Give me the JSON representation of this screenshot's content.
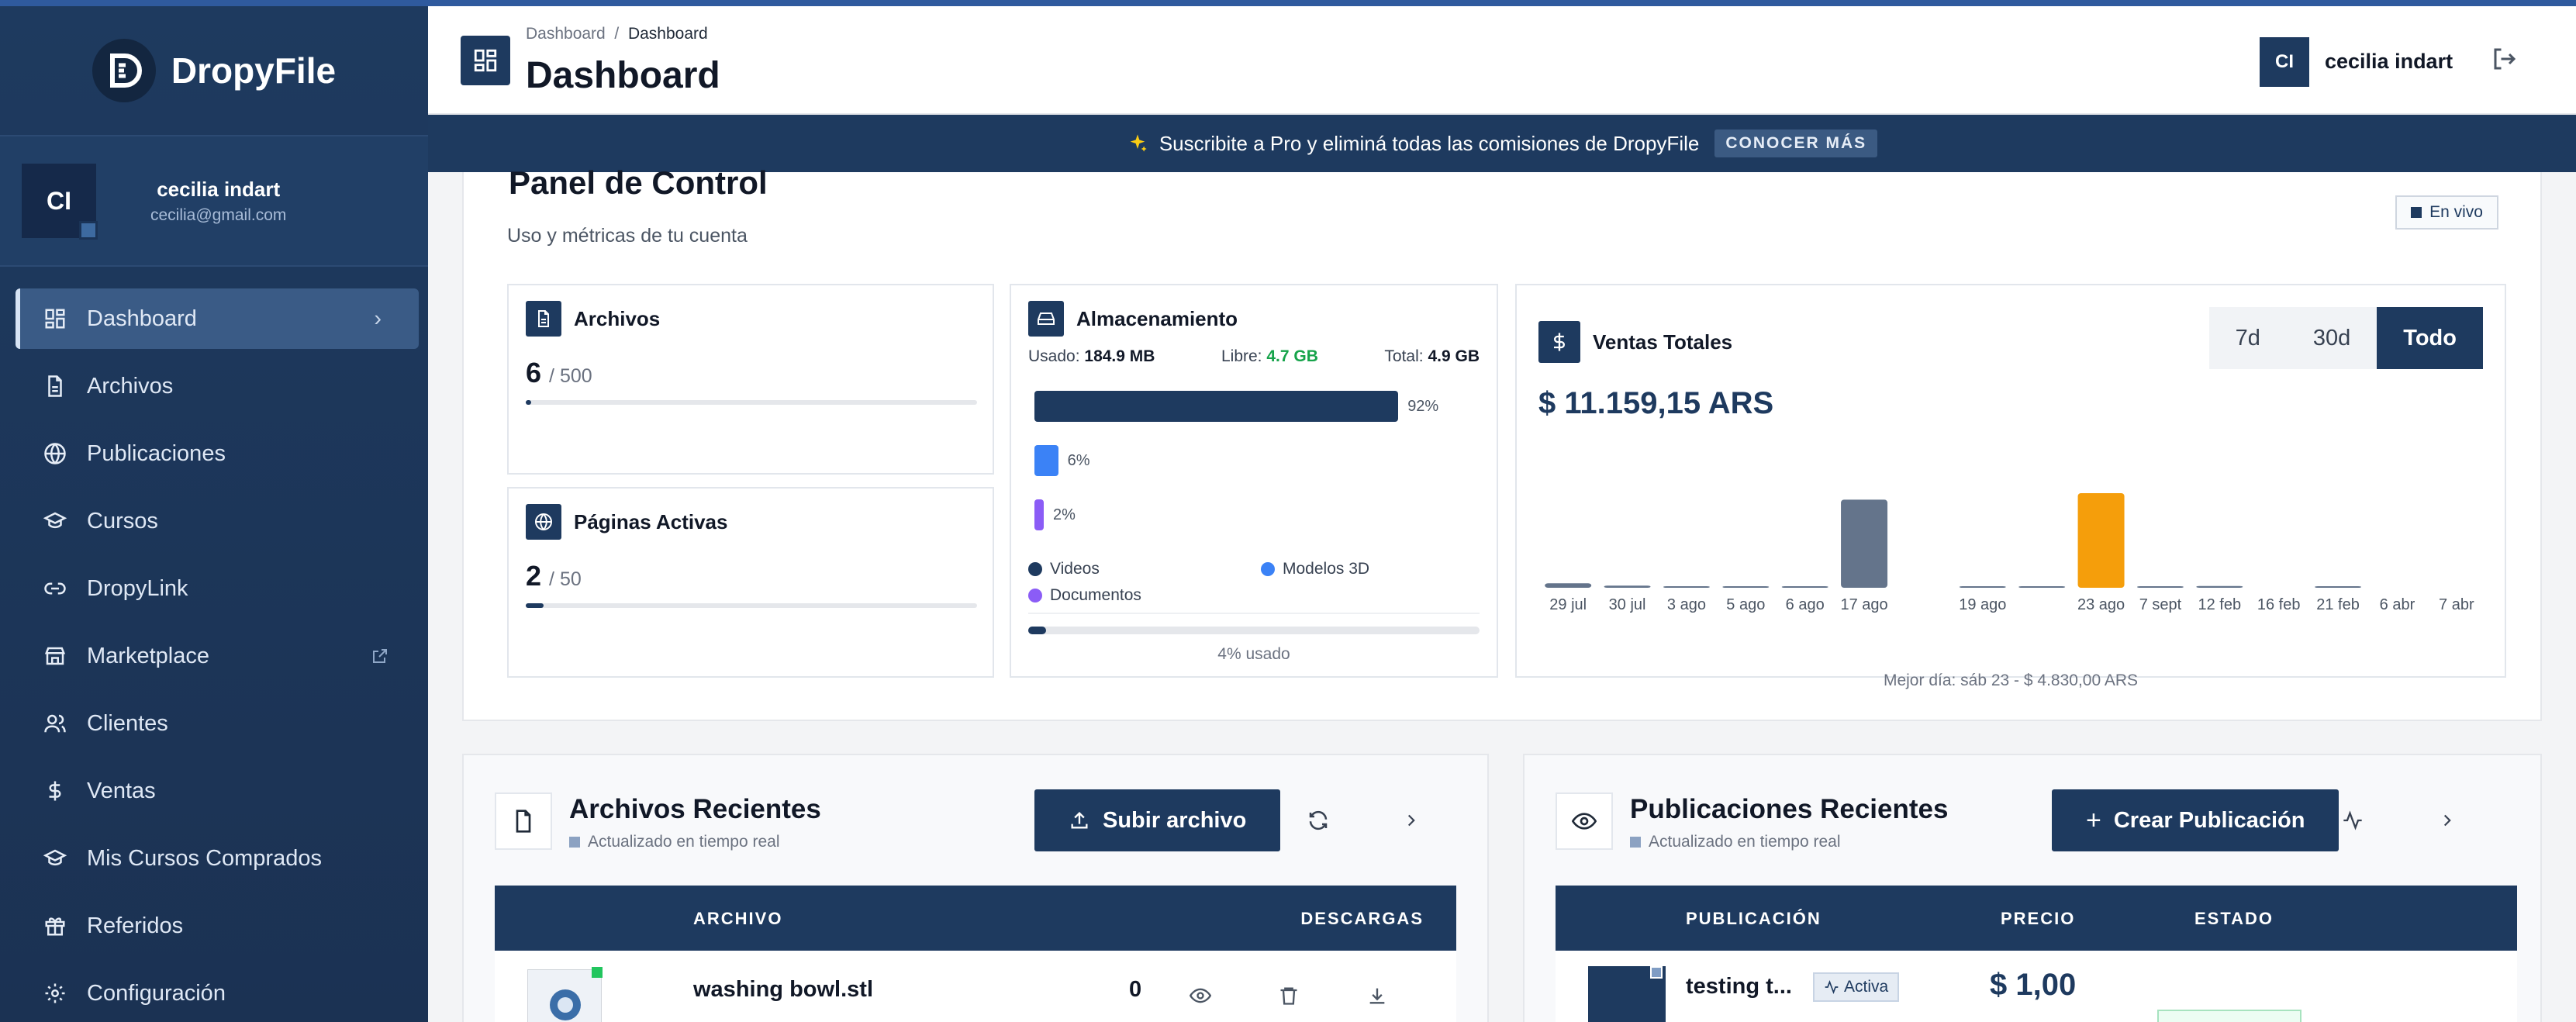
{
  "app": {
    "name": "DropyFile"
  },
  "sidebar": {
    "user": {
      "initials": "CI",
      "name": "cecilia indart",
      "email": "cecilia@gmail.com"
    },
    "items": [
      {
        "label": "Dashboard",
        "icon": "grid-icon"
      },
      {
        "label": "Archivos",
        "icon": "file-icon"
      },
      {
        "label": "Publicaciones",
        "icon": "globe-icon"
      },
      {
        "label": "Cursos",
        "icon": "graduation-cap-icon"
      },
      {
        "label": "DropyLink",
        "icon": "link-icon"
      },
      {
        "label": "Marketplace",
        "icon": "store-icon"
      },
      {
        "label": "Clientes",
        "icon": "users-icon"
      },
      {
        "label": "Ventas",
        "icon": "dollar-icon"
      },
      {
        "label": "Mis Cursos Comprados",
        "icon": "graduation-cap-icon"
      },
      {
        "label": "Referidos",
        "icon": "gift-icon"
      },
      {
        "label": "Configuración",
        "icon": "gear-icon"
      }
    ]
  },
  "header": {
    "breadcrumb": [
      "Dashboard",
      "Dashboard"
    ],
    "title": "Dashboard",
    "user_initials": "CI",
    "user_name": "cecilia indart"
  },
  "banner": {
    "text": "Suscribite a Pro y eliminá todas las comisiones de DropyFile",
    "cta": "CONOCER MÁS"
  },
  "panel": {
    "title": "Panel de Control",
    "subtitle": "Uso y métricas de tu cuenta",
    "live_label": "En vivo",
    "archivos": {
      "title": "Archivos",
      "count": "6",
      "limit": "/ 500",
      "fraction": 0.012
    },
    "paginas": {
      "title": "Páginas Activas",
      "count": "2",
      "limit": "/ 50",
      "fraction": 0.04
    },
    "storage": {
      "title": "Almacenamiento",
      "used_label": "Usado:",
      "used": "184.9 MB",
      "free_label": "Libre:",
      "free": "4.7 GB",
      "total_label": "Total:",
      "total": "4.9 GB",
      "bars": [
        {
          "label": "Videos",
          "percent": 92,
          "percent_label": "92%",
          "color": "#1e3a5f"
        },
        {
          "label": "Modelos 3D",
          "percent": 6,
          "percent_label": "6%",
          "color": "#3b82f6"
        },
        {
          "label": "Documentos",
          "percent": 2,
          "percent_label": "2%",
          "color": "#8b5cf6"
        }
      ],
      "used_fraction": 0.04,
      "used_caption": "4% usado"
    },
    "ventas": {
      "title": "Ventas Totales",
      "total": "$ 11.159,15 ARS",
      "periods": [
        "7d",
        "30d",
        "Todo"
      ],
      "selected_period": "Todo",
      "best_day": "Mejor día: sáb 23 - $ 4.830,00 ARS"
    }
  },
  "chart_data": {
    "type": "bar",
    "categories": [
      "29 jul",
      "30 jul",
      "3 ago",
      "5 ago",
      "6 ago",
      "17 ago",
      "",
      "19 ago",
      "",
      "23 ago",
      "7 sept",
      "12 feb",
      "16 feb",
      "21 feb",
      "6 abr",
      "7 abr"
    ],
    "values": [
      230,
      110,
      40,
      40,
      50,
      4500,
      0,
      60,
      10,
      4830,
      60,
      90,
      0,
      40,
      0,
      0
    ],
    "highlight_index": 9,
    "ylim": [
      0,
      4830
    ],
    "colors": {
      "default": "#64748b",
      "highlight": "#f59e0b"
    }
  },
  "recent_files": {
    "title": "Archivos Recientes",
    "subtitle": "Actualizado en tiempo real",
    "upload_label": "Subir archivo",
    "columns": [
      "ARCHIVO",
      "DESCARGAS"
    ],
    "rows": [
      {
        "name": "washing bowl.stl",
        "downloads": "0"
      }
    ]
  },
  "recent_pubs": {
    "title": "Publicaciones Recientes",
    "subtitle": "Actualizado en tiempo real",
    "create_label": "Crear Publicación",
    "columns": [
      "PUBLICACIÓN",
      "PRECIO",
      "ESTADO"
    ],
    "rows": [
      {
        "name": "testing t...",
        "badge": "Activa",
        "price": "$ 1,00"
      }
    ]
  }
}
